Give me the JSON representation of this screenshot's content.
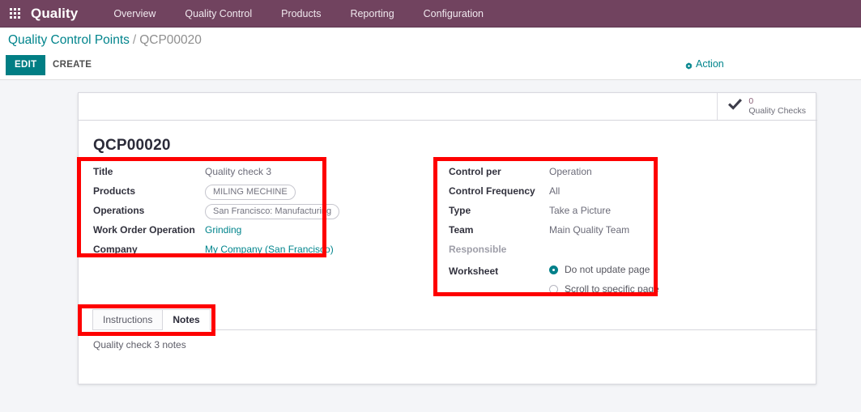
{
  "navbar": {
    "apps_icon": "apps-grid-icon",
    "brand": "Quality",
    "items": [
      {
        "label": "Overview"
      },
      {
        "label": "Quality Control"
      },
      {
        "label": "Products"
      },
      {
        "label": "Reporting"
      },
      {
        "label": "Configuration"
      }
    ],
    "bg_color": "#71435f"
  },
  "breadcrumb": {
    "parent": "Quality Control Points",
    "separator": "/",
    "current": "QCP00020",
    "link_color": "#00848c"
  },
  "control_panel": {
    "edit_label": "EDIT",
    "create_label": "CREATE",
    "action_label": "Action",
    "action_icon": "gear-icon",
    "edit_color": "#017e84"
  },
  "stat_buttons": [
    {
      "icon": "check-icon",
      "value": "0",
      "label": "Quality Checks"
    }
  ],
  "record": {
    "title": "QCP00020"
  },
  "group_left": {
    "fields": [
      {
        "label": "Title",
        "value": "Quality check 3",
        "kind": "text"
      },
      {
        "label": "Products",
        "value": "MILING MECHINE",
        "kind": "badge"
      },
      {
        "label": "Operations",
        "value": "San Francisco: Manufacturing",
        "kind": "badge"
      },
      {
        "label": "Work Order Operation",
        "value": "Grinding",
        "kind": "link"
      },
      {
        "label": "Company",
        "value": "My Company (San Francisco)",
        "kind": "link"
      }
    ]
  },
  "group_right": {
    "fields": [
      {
        "label": "Control per",
        "value": "Operation",
        "kind": "text"
      },
      {
        "label": "Control Frequency",
        "value": "All",
        "kind": "text"
      },
      {
        "label": "Type",
        "value": "Take a Picture",
        "kind": "text"
      },
      {
        "label": "Team",
        "value": "Main Quality Team",
        "kind": "text"
      },
      {
        "label": "Responsible",
        "value": "",
        "kind": "empty"
      }
    ],
    "worksheet": {
      "label": "Worksheet",
      "options": [
        {
          "label": "Do not update page",
          "selected": true
        },
        {
          "label": "Scroll to specific page",
          "selected": false
        }
      ],
      "selected_color": "#00808a"
    }
  },
  "notebook": {
    "tabs": [
      {
        "label": "Instructions",
        "active": false
      },
      {
        "label": "Notes",
        "active": true
      }
    ],
    "content": "Quality check 3 notes"
  },
  "annotations": {
    "color": "#fe0000",
    "boxes": [
      {
        "name": "left-fields-highlight"
      },
      {
        "name": "right-fields-highlight"
      },
      {
        "name": "tabs-highlight"
      }
    ]
  }
}
